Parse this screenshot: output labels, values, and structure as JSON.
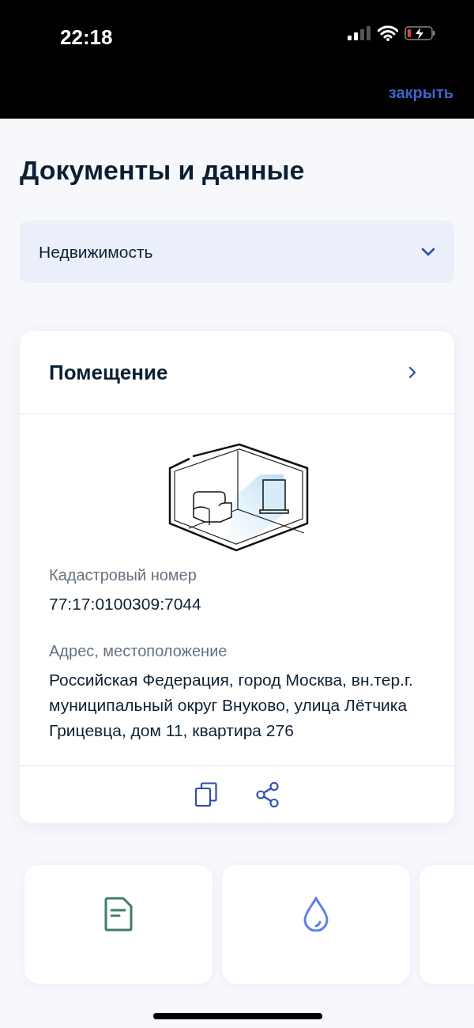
{
  "status_bar": {
    "time": "22:18"
  },
  "header": {
    "close_link": "закрыть"
  },
  "title": "Документы и данные",
  "category_select": {
    "value": "Недвижимость"
  },
  "card": {
    "title": "Помещение",
    "fields": [
      {
        "label": "Кадастровый номер",
        "value": "77:17:0100309:7044"
      },
      {
        "label": "Адрес, местоположение",
        "value": "Российская Федерация, город Москва, вн.тер.г. муниципальный округ Внуково, улица Лётчика Грицевца, дом 11, квартира 276"
      }
    ]
  }
}
